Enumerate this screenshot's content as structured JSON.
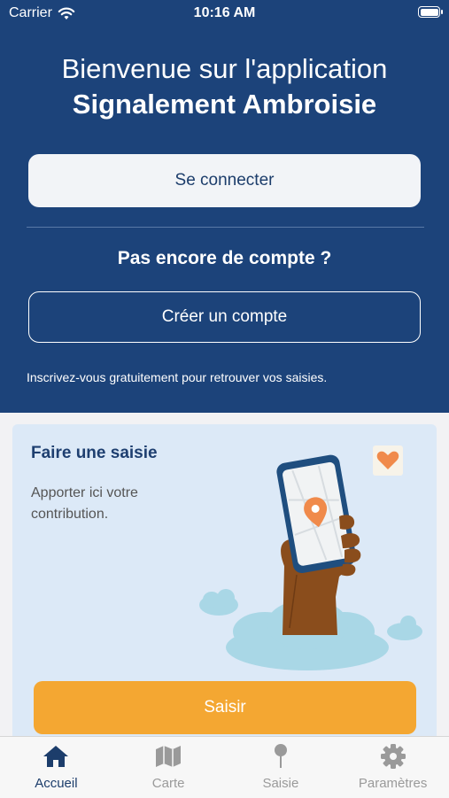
{
  "status_bar": {
    "carrier": "Carrier",
    "time": "10:16 AM"
  },
  "welcome": {
    "line1": "Bienvenue sur l'application",
    "line2": "Signalement Ambroisie"
  },
  "auth": {
    "login_label": "Se connecter",
    "no_account_title": "Pas encore de compte ?",
    "create_label": "Créer un compte",
    "signup_hint": "Inscrivez-vous gratuitement pour retrouver vos saisies."
  },
  "card": {
    "title": "Faire une saisie",
    "description": "Apporter ici votre contribution.",
    "button_label": "Saisir"
  },
  "tabs": [
    {
      "label": "Accueil",
      "icon": "home-icon",
      "active": true
    },
    {
      "label": "Carte",
      "icon": "map-icon",
      "active": false
    },
    {
      "label": "Saisie",
      "icon": "pin-icon",
      "active": false
    },
    {
      "label": "Paramètres",
      "icon": "gear-icon",
      "active": false
    }
  ],
  "colors": {
    "header_bg": "#1c437a",
    "accent": "#f4a732",
    "card_bg": "#dce9f7",
    "active_tab": "#1c3d6b",
    "inactive_tab": "#9a9a9a"
  }
}
